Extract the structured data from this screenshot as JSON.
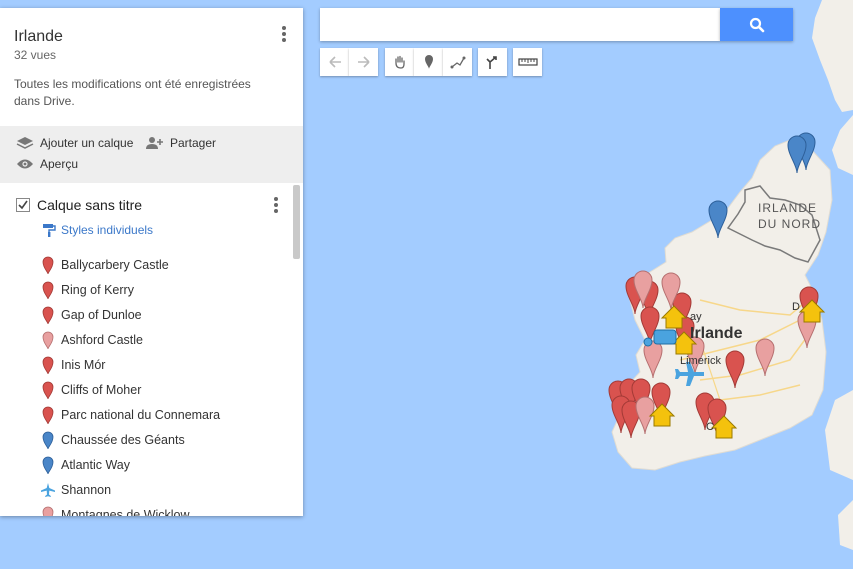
{
  "panel": {
    "title": "Irlande",
    "views": "32 vues",
    "saved_message": "Toutes les modifications ont été enregistrées dans Drive.",
    "actions": {
      "add_layer": "Ajouter un calque",
      "share": "Partager",
      "preview": "Aperçu"
    },
    "layer": {
      "title": "Calque sans titre",
      "styles_link": "Styles individuels",
      "items": [
        {
          "label": "Ballycarbery Castle",
          "icon": "red-pin-icon",
          "color": "#d9534f"
        },
        {
          "label": "Ring of Kerry",
          "icon": "red-pin-icon",
          "color": "#d9534f"
        },
        {
          "label": "Gap of Dunloe",
          "icon": "red-pin-icon",
          "color": "#d9534f"
        },
        {
          "label": "Ashford Castle",
          "icon": "pink-pin-icon",
          "color": "#e8a0a0"
        },
        {
          "label": "Inis Mór",
          "icon": "red-pin-icon",
          "color": "#d9534f"
        },
        {
          "label": "Cliffs of Moher",
          "icon": "red-pin-icon",
          "color": "#d9534f"
        },
        {
          "label": "Parc national du Connemara",
          "icon": "red-pin-icon",
          "color": "#d9534f"
        },
        {
          "label": "Chaussée des Géants",
          "icon": "blue-pin-icon",
          "color": "#4a86c8"
        },
        {
          "label": "Atlantic Way",
          "icon": "blue-pin-icon",
          "color": "#4a86c8"
        },
        {
          "label": "Shannon",
          "icon": "airplane-icon",
          "color": "#4aa3df"
        },
        {
          "label": "Montagnes de Wicklow",
          "icon": "pink-pin-icon",
          "color": "#e8a0a0"
        }
      ]
    }
  },
  "search": {
    "value": "",
    "placeholder": ""
  },
  "map_labels": {
    "northern_ireland_line1": "IRLANDE",
    "northern_ireland_line2": "DU NORD",
    "ireland": "Irlande",
    "limerick": "Limerick",
    "galway_fragment": "ay",
    "dublin_fragment": "D",
    "cork_fragment": "C"
  },
  "colors": {
    "sea": "#a3ccff",
    "land": "#f2efe9",
    "accent": "#4d90fe",
    "pin_red": "#d9534f",
    "pin_pink": "#e8a0a0",
    "pin_blue": "#4a86c8",
    "house": "#f4c20d"
  }
}
